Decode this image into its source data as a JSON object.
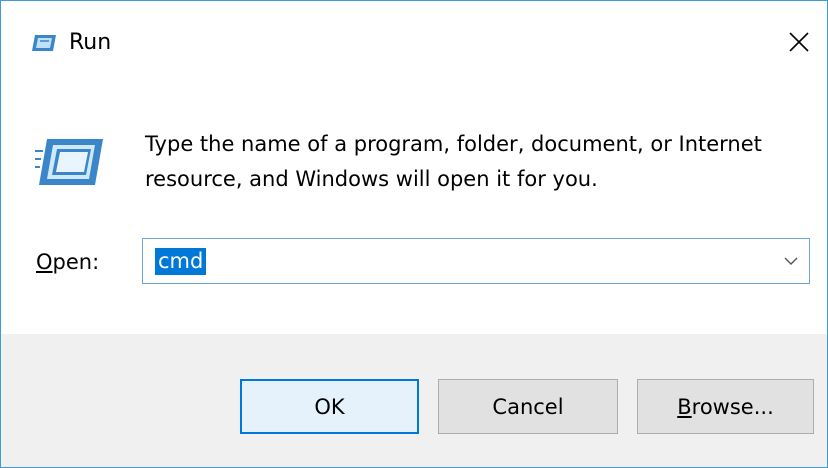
{
  "window": {
    "title": "Run"
  },
  "description": "Type the name of a program, folder, document, or Internet resource, and Windows will open it for you.",
  "open_field": {
    "label_accel": "O",
    "label_rest": "pen:",
    "value": "cmd"
  },
  "buttons": {
    "ok": "OK",
    "cancel": "Cancel",
    "browse_accel": "B",
    "browse_rest": "rowse..."
  },
  "icons": {
    "title": "run-icon",
    "close": "close-icon",
    "large": "run-icon",
    "dropdown": "chevron-down-icon"
  },
  "colors": {
    "accent": "#0078d7",
    "window_border": "#3d9bd6",
    "footer_bg": "#f0f0f0",
    "button_bg": "#e1e1e1",
    "ok_bg": "#e5f1fb"
  }
}
